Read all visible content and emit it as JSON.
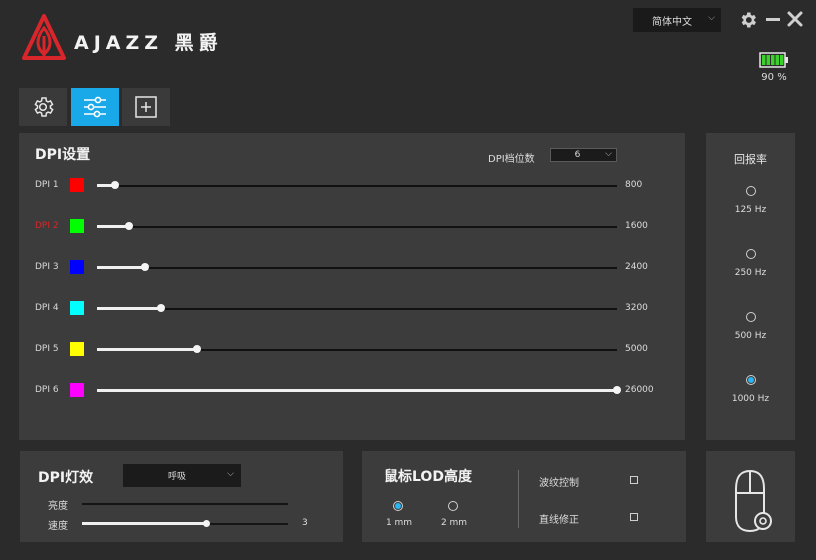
{
  "header": {
    "brand": "AJAZZ 黑爵",
    "language": "简体中文",
    "battery_percent_label": "90 %",
    "battery_level": 0.9
  },
  "tabs": [
    {
      "name": "settings",
      "icon": "gear-icon",
      "active": false
    },
    {
      "name": "dpi",
      "icon": "sliders-icon",
      "active": true
    },
    {
      "name": "macro",
      "icon": "plus-square-icon",
      "active": false
    }
  ],
  "dpi": {
    "title": "DPI设置",
    "levels_label": "DPI档位数",
    "levels_value": "6",
    "max": 26000,
    "rows": [
      {
        "label": "DPI 1",
        "color": "#ff0000",
        "value": 800,
        "value_text": "800",
        "selected": false
      },
      {
        "label": "DPI 2",
        "color": "#00ff00",
        "value": 1600,
        "value_text": "1600",
        "selected": true
      },
      {
        "label": "DPI 3",
        "color": "#0000ff",
        "value": 2400,
        "value_text": "2400",
        "selected": false
      },
      {
        "label": "DPI 4",
        "color": "#00ffff",
        "value": 3200,
        "value_text": "3200",
        "selected": false
      },
      {
        "label": "DPI 5",
        "color": "#ffff00",
        "value": 5000,
        "value_text": "5000",
        "selected": false
      },
      {
        "label": "DPI 6",
        "color": "#ff00ff",
        "value": 26000,
        "value_text": "26000",
        "selected": false
      }
    ]
  },
  "report_rate": {
    "title": "回报率",
    "options": [
      {
        "label": "125 Hz",
        "selected": false
      },
      {
        "label": "250 Hz",
        "selected": false
      },
      {
        "label": "500 Hz",
        "selected": false
      },
      {
        "label": "1000 Hz",
        "selected": true
      }
    ]
  },
  "dpi_effect": {
    "title": "DPI灯效",
    "mode": "呼吸",
    "brightness_label": "亮度",
    "brightness_level": 0,
    "speed_label": "速度",
    "speed_value": "3",
    "speed_level": 0.6
  },
  "lod": {
    "title": "鼠标LOD高度",
    "options": [
      {
        "label": "1 mm",
        "selected": true
      },
      {
        "label": "2 mm",
        "selected": false
      }
    ],
    "ripple_label": "波纹控制",
    "ripple_checked": false,
    "straight_label": "直线修正",
    "straight_checked": false
  },
  "colors": {
    "accent": "#1aa9e8",
    "radio_on": "#2ab4f0",
    "selected_label": "#d8262b",
    "logo_red": "#d8262b"
  }
}
